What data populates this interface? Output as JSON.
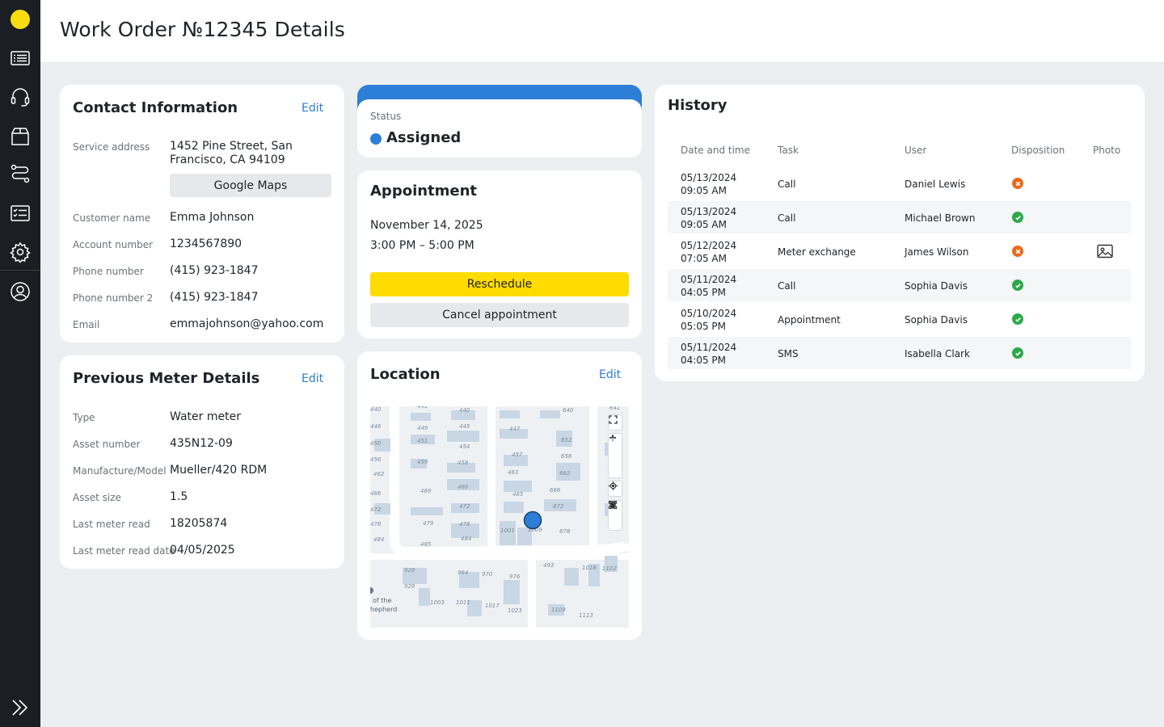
{
  "header": {
    "title": "Work Order №12345 Details"
  },
  "contact": {
    "title": "Contact Information",
    "edit_label": "Edit",
    "service_address_label": "Service address",
    "service_address_line1": "1452 Pine Street, San",
    "service_address_line2": "Francisco, CA 94109",
    "maps_button": "Google Maps",
    "customer_name_label": "Customer name",
    "customer_name": "Emma Johnson",
    "account_number_label": "Account number",
    "account_number": "1234567890",
    "phone_label": "Phone number",
    "phone": "(415) 923-1847",
    "phone2_label": "Phone number 2",
    "phone2": "(415) 923-1847",
    "email_label": "Email",
    "email": "emmajohnson@yahoo.com"
  },
  "meter": {
    "title": "Previous Meter Details",
    "edit_label": "Edit",
    "type_label": "Type",
    "type": "Water meter",
    "asset_number_label": "Asset number",
    "asset_number": "435N12-09",
    "model_label": "Manufacture/Model",
    "model": "Mueller/420 RDM",
    "asset_size_label": "Asset size",
    "asset_size": "1.5",
    "last_read_label": "Last meter read",
    "last_read": "18205874",
    "last_read_date_label": "Last meter read date",
    "last_read_date": "04/05/2025"
  },
  "status": {
    "label": "Status",
    "value": "Assigned",
    "color": "#2d7ed6"
  },
  "appointment": {
    "title": "Appointment",
    "date": "November 14, 2025",
    "time": "3:00 PM – 5:00 PM",
    "reschedule_label": "Reschedule",
    "cancel_label": "Cancel appointment"
  },
  "location": {
    "title": "Location",
    "edit_label": "Edit",
    "map_labels": {
      "parish_line1": "of the",
      "parish_line2": "hepherd",
      "n441": "441",
      "n440": "440",
      "n446": "446",
      "n449": "449",
      "n445": "445",
      "n450": "450",
      "n451": "451",
      "n454": "454",
      "n456": "456",
      "n459": "459",
      "n458": "458",
      "n462": "462",
      "n469": "469",
      "n466": "466",
      "n472": "472",
      "n479": "479",
      "n478": "478",
      "n484": "484",
      "n485": "485",
      "n447": "447",
      "n457": "457",
      "n463": "463",
      "n465": "465",
      "n640": "640",
      "n652": "652",
      "n656": "656",
      "n662": "662",
      "n666": "666",
      "n672": "672",
      "n678": "678",
      "n1001": "1001",
      "n1009": "1009",
      "n929a": "929",
      "n929b": "929",
      "n964": "964",
      "n970": "970",
      "n976": "976",
      "n1003": "1003",
      "n1011": "1011",
      "n1017": "1017",
      "n1023": "1023",
      "n493": "493",
      "n1018": "1018",
      "n1102": "1102",
      "n1109": "1109",
      "n1113": "1113",
      "n641": "641"
    }
  },
  "history": {
    "title": "History",
    "columns": {
      "date": "Date and time",
      "task": "Task",
      "user": "User",
      "disposition": "Disposition",
      "photo": "Photo"
    },
    "rows": [
      {
        "date": "05/13/2024",
        "time": "09:05 AM",
        "task": "Call",
        "user": "Daniel Lewis",
        "disposition": "fail",
        "photo": false
      },
      {
        "date": "05/13/2024",
        "time": "09:05 AM",
        "task": "Call",
        "user": "Michael Brown",
        "disposition": "ok",
        "photo": false
      },
      {
        "date": "05/12/2024",
        "time": "07:05 AM",
        "task": "Meter exchange",
        "user": "James Wilson",
        "disposition": "fail",
        "photo": true
      },
      {
        "date": "05/11/2024",
        "time": "04:05 PM",
        "task": "Call",
        "user": "Sophia Davis",
        "disposition": "ok",
        "photo": false
      },
      {
        "date": "05/10/2024",
        "time": "05:05 PM",
        "task": "Appointment",
        "user": "Sophia Davis",
        "disposition": "ok",
        "photo": false
      },
      {
        "date": "05/11/2024",
        "time": "04:05 PM",
        "task": "SMS",
        "user": "Isabella Clark",
        "disposition": "ok",
        "photo": false
      }
    ]
  },
  "sidebar": {
    "items": [
      "list-icon",
      "headset-icon",
      "box-icon",
      "route-icon",
      "checklist-icon",
      "settings-icon",
      "user-icon"
    ],
    "expand": "expand-icon"
  },
  "colors": {
    "accent": "#2d7ed6",
    "yellow": "#fedc00",
    "ok": "#2ea84a",
    "fail": "#ea6a1b"
  }
}
